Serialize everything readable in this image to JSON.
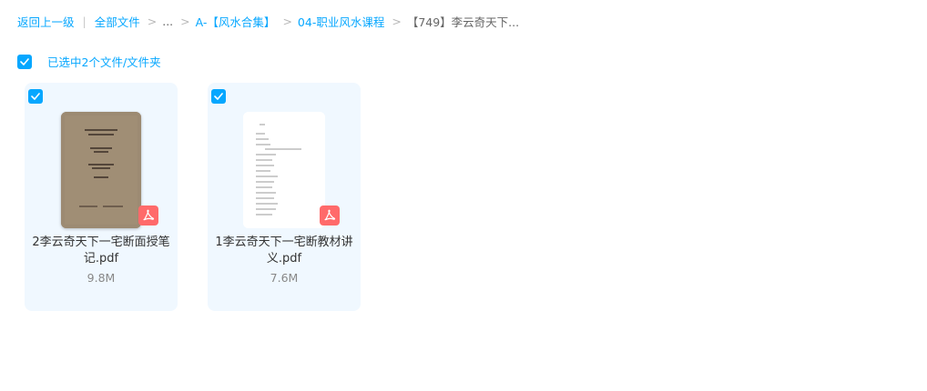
{
  "breadcrumb": {
    "back": "返回上一级",
    "all_files": "全部文件",
    "ellipsis": "...",
    "folder1": "A-【风水合集】",
    "folder2": "04-职业风水课程",
    "current": "【749】李云奇天下..."
  },
  "selection": {
    "text": "已选中2个文件/文件夹"
  },
  "files": [
    {
      "name": "2李云奇天下一宅断面授笔记.pdf",
      "size": "9.8M",
      "type_icon": "pdf-icon"
    },
    {
      "name": "1李云奇天下一宅断教材讲义.pdf",
      "size": "7.6M",
      "type_icon": "pdf-icon"
    }
  ],
  "colors": {
    "accent": "#06a7ff",
    "card_bg": "#f0f8ff",
    "pdf_red": "#ff6a6a"
  }
}
